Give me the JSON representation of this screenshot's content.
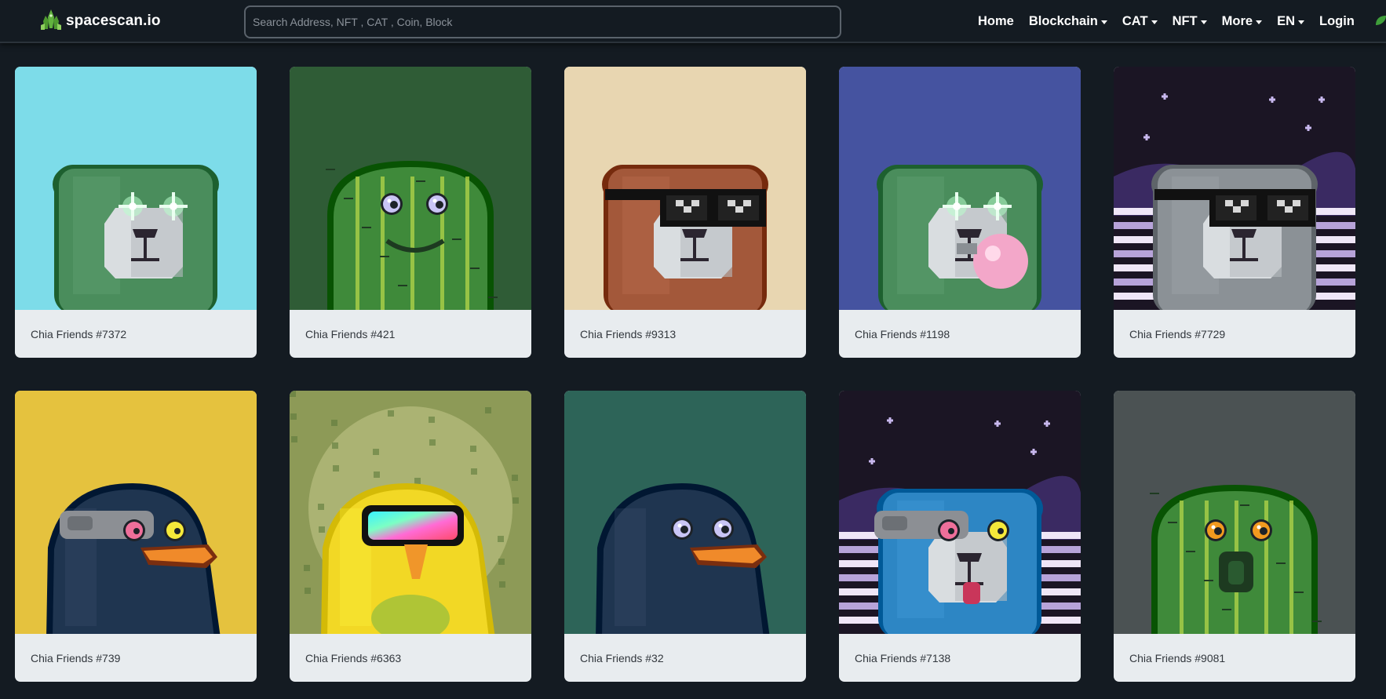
{
  "header": {
    "brand": "spacescan.io",
    "search_placeholder": "Search Address, NFT , CAT , Coin, Block",
    "nav": [
      {
        "label": "Home",
        "dropdown": false
      },
      {
        "label": "Blockchain",
        "dropdown": true
      },
      {
        "label": "CAT",
        "dropdown": true
      },
      {
        "label": "NFT",
        "dropdown": true
      },
      {
        "label": "More",
        "dropdown": true
      },
      {
        "label": "EN",
        "dropdown": true
      },
      {
        "label": "Login",
        "dropdown": false
      }
    ]
  },
  "nft_cards": [
    {
      "title": "Chia Friends #7372",
      "character": "bear",
      "bg": "#7ddce9",
      "body": "#4a8d5c",
      "eyes": "laser",
      "accessory": "none"
    },
    {
      "title": "Chia Friends #421",
      "character": "cactus",
      "bg": "#2f5c36",
      "body": "#3f8a3a",
      "eyes": "lavender",
      "accessory": "smile"
    },
    {
      "title": "Chia Friends #9313",
      "character": "bear",
      "bg": "#e8d6b1",
      "body": "#a3583a",
      "eyes": "none",
      "accessory": "sunglasses"
    },
    {
      "title": "Chia Friends #1198",
      "character": "bear",
      "bg": "#4553a0",
      "body": "#4a8d5c",
      "eyes": "laser",
      "accessory": "bubblegum"
    },
    {
      "title": "Chia Friends #7729",
      "character": "bear",
      "bg": "#1b1524",
      "body": "#8b9196",
      "eyes": "none",
      "accessory": "sunglasses",
      "scene": "space"
    },
    {
      "title": "Chia Friends #739",
      "character": "bird",
      "bg": "#e1b73a",
      "body": "#1f3550",
      "eyes": "cyborg",
      "accessory": "beak"
    },
    {
      "title": "Chia Friends #6363",
      "character": "bird",
      "bg": "#8d9a57",
      "body": "#f2d825",
      "eyes": "none",
      "accessory": "rainbow-goggles"
    },
    {
      "title": "Chia Friends #32",
      "character": "bird",
      "bg": "#2d6458",
      "body": "#1f3550",
      "eyes": "lavender",
      "accessory": "beak"
    },
    {
      "title": "Chia Friends #7138",
      "character": "bear",
      "bg": "#1b1524",
      "body": "#2d86c4",
      "eyes": "cyborg",
      "accessory": "tongue",
      "scene": "space"
    },
    {
      "title": "Chia Friends #9081",
      "character": "cactus",
      "bg": "#4b5253",
      "body": "#3f8a3a",
      "eyes": "orange",
      "accessory": "open-mouth"
    }
  ],
  "colors": {
    "page_bg": "#141b22",
    "card_caption_bg": "#e8ecef",
    "brand_green": "#62b33f"
  }
}
